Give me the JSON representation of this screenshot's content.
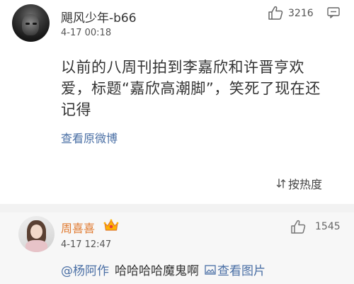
{
  "comment": {
    "username": "飓风少年-b66",
    "timestamp": "4-17 00:18",
    "like_count": "3216",
    "content": "以前的八周刊拍到李嘉欣和许晋亨欢爱，标题“嘉欣高潮脚”，笑死了现在还记得",
    "view_original": "查看原微博"
  },
  "sort": {
    "label": "按热度"
  },
  "reply": {
    "username": "周喜喜",
    "like_count": "1545",
    "timestamp": "4-17 12:47",
    "mention": "@杨阿作",
    "text": "哈哈哈哈魔鬼啊",
    "pic_link": "查看图片"
  },
  "colors": {
    "link_blue": "#4a6fa5",
    "reply_name_orange": "#e07a2f",
    "text_dark": "#333333",
    "reply_bg": "#f7f7f7"
  }
}
